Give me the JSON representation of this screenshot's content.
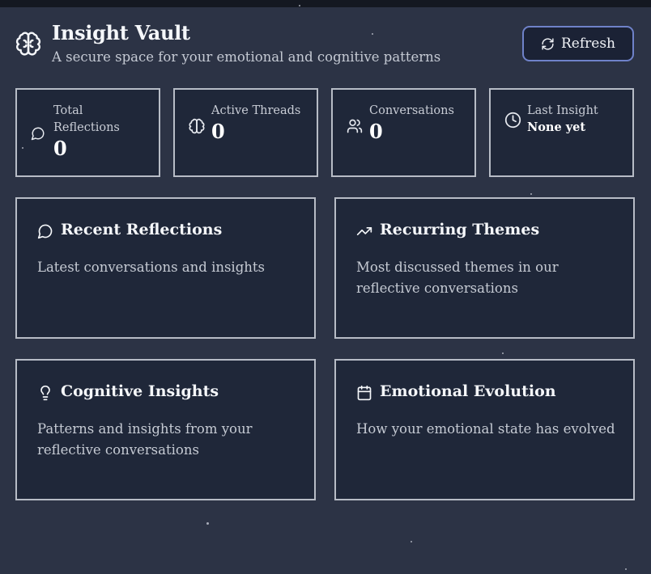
{
  "header": {
    "title": "Insight Vault",
    "subtitle": "A secure space for your emotional and cognitive patterns",
    "refresh_label": "Refresh",
    "icon": "brain-icon"
  },
  "stats": [
    {
      "label": "Total Reflections",
      "value": "0",
      "icon": "message-circle-icon"
    },
    {
      "label": "Active Threads",
      "value": "0",
      "icon": "brain-icon"
    },
    {
      "label": "Conversations",
      "value": "0",
      "icon": "users-icon"
    },
    {
      "label": "Last Insight",
      "value": "None yet",
      "icon": "clock-icon"
    }
  ],
  "cards": [
    {
      "title": "Recent Reflections",
      "description": "Latest conversations and insights",
      "icon": "message-circle-icon"
    },
    {
      "title": "Recurring Themes",
      "description": "Most discussed themes in our reflective conversations",
      "icon": "trending-up-icon"
    },
    {
      "title": "Cognitive Insights",
      "description": "Patterns and insights from your reflective conversations",
      "icon": "lightbulb-icon"
    },
    {
      "title": "Emotional Evolution",
      "description": "How your emotional state has evolved",
      "icon": "calendar-icon"
    }
  ],
  "colors": {
    "background": "#2c3345",
    "panel": "#1f2739",
    "border": "#b7bcc6",
    "accent": "#6f82c9"
  }
}
